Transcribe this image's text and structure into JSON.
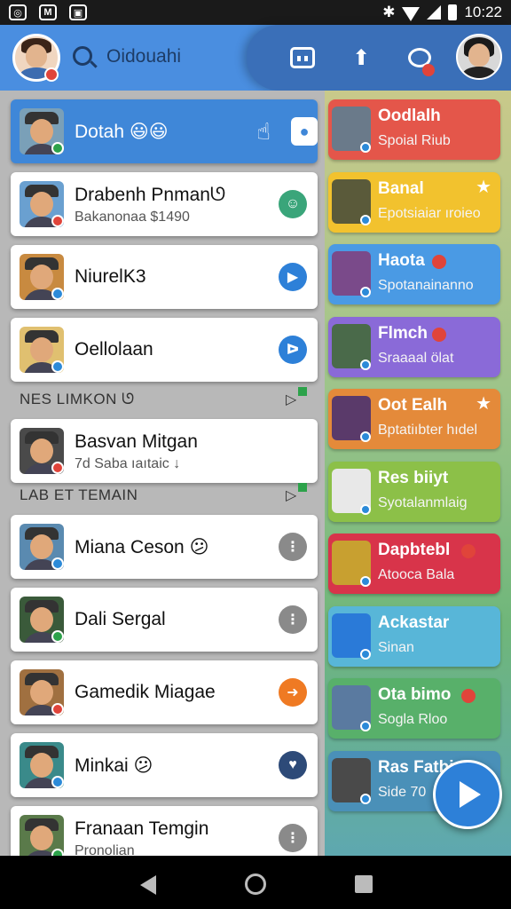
{
  "status_bar": {
    "time": "10:22",
    "left_icons": [
      "notification-icon",
      "app-icon",
      "gallery-icon"
    ]
  },
  "header": {
    "search_text": "Oidouahi",
    "icons": [
      "bot-icon",
      "share-icon",
      "chat-icon"
    ]
  },
  "contacts": [
    {
      "name": "Dotah 😃😃",
      "active": true
    },
    {
      "name": "Drabenh Pnmanᘎ",
      "sub": "Bakanonaa $1490",
      "dot": "#e0443a",
      "action_color": "#3aa57a",
      "action_glyph": "☺"
    },
    {
      "name": "NiurelK3",
      "dot": "#2c8ad8",
      "action_color": "#2d80d8",
      "action_glyph": "▶"
    },
    {
      "name": "Oellolaan",
      "dot": "#2c8ad8",
      "action_color": "#2d80d8",
      "action_glyph": "ᐅ"
    }
  ],
  "sections": [
    {
      "label": "NES LIMKON ᘎ"
    },
    {
      "label": "LAB ET TEMAIN"
    }
  ],
  "section1_contacts": [
    {
      "name": "Basvan Mitgan",
      "sub": "7d Saba ıaıtaic  ↓",
      "dot": "#e0443a"
    }
  ],
  "section2_contacts": [
    {
      "name": "Miana Ceson 😕",
      "dot": "#2c8ad8",
      "action_color": "#8a8a8a",
      "action_glyph": "⋮"
    },
    {
      "name": "Dali Sergal",
      "dot": "#2ca24a",
      "action_color": "#8a8a8a",
      "action_glyph": "⋮"
    },
    {
      "name": "Gamedik Miagae",
      "dot": "#e0443a",
      "action_color": "#ef7a23",
      "action_glyph": "➜"
    },
    {
      "name": "Minkai 😕",
      "dot": "#2c8ad8",
      "action_color": "#2d4a78",
      "action_glyph": "♥"
    },
    {
      "name": "Franaan Temgin",
      "sub": "Pronolian",
      "dot": "#2ca24a",
      "action_color": "#8a8a8a",
      "action_glyph": "⋮"
    }
  ],
  "groups": [
    {
      "name": "Oodlalh",
      "sub": "Spoial Riub",
      "color": "#e4564a"
    },
    {
      "name": "Banal",
      "sub": "Epotsiaiar ıroieo",
      "color": "#f2c22e",
      "star": "★"
    },
    {
      "name": "Haota",
      "sub": "Spotanainanno",
      "color": "#4a9ae4",
      "redot": true
    },
    {
      "name": "Flmch",
      "sub": "Sraaaal ölat",
      "color": "#8a6ad8",
      "redot": true
    },
    {
      "name": "Oot Ealh",
      "sub": "Bptatiıbter hıdel",
      "color": "#e48a3a",
      "star": "★"
    },
    {
      "name": "Res biiyt",
      "sub": "Syotalanmlaig",
      "color": "#8cc048"
    },
    {
      "name": "Dapbtebl",
      "sub": "Atooca Bala",
      "color": "#d8344a",
      "redot": true
    },
    {
      "name": "Ackastar",
      "sub": "Sinan",
      "color": "#58b6d8"
    },
    {
      "name": "Ota bimo",
      "sub": "Sogla Rloo",
      "color": "#58b06a",
      "redot": true
    },
    {
      "name": "Ras Fatbir",
      "sub": "Side 70",
      "color": "#4a90b8"
    }
  ]
}
